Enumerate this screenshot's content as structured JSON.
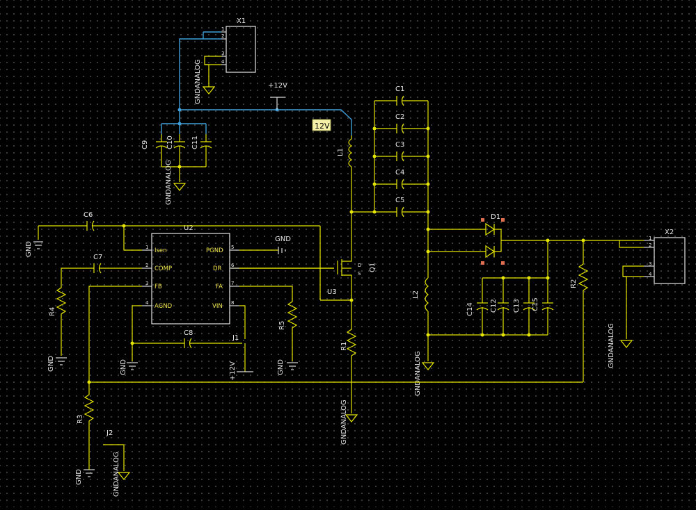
{
  "schematic": {
    "net_tag": "12V",
    "power_label": "+12V",
    "components": {
      "x1": {
        "ref": "X1",
        "pins": [
          "1",
          "2",
          "3",
          "4"
        ]
      },
      "x2": {
        "ref": "X2",
        "pins": [
          "1",
          "2",
          "3",
          "4"
        ]
      },
      "u2": {
        "ref": "U2",
        "left_pins": [
          {
            "num": "1",
            "name": "Isen"
          },
          {
            "num": "2",
            "name": "COMP"
          },
          {
            "num": "3",
            "name": "FB"
          },
          {
            "num": "4",
            "name": "AGND"
          }
        ],
        "right_pins": [
          {
            "num": "5",
            "name": "PGND"
          },
          {
            "num": "6",
            "name": "DR"
          },
          {
            "num": "7",
            "name": "FA"
          },
          {
            "num": "8",
            "name": "VIN"
          }
        ]
      },
      "u3": {
        "ref": "U3"
      },
      "q1": {
        "ref": "Q1",
        "pin_a": "D",
        "pin_b": "S"
      },
      "d1": {
        "ref": "D1"
      },
      "l1": {
        "ref": "L1"
      },
      "l2": {
        "ref": "L2"
      },
      "j1": {
        "ref": "J1"
      },
      "j2": {
        "ref": "J2"
      },
      "caps": [
        "C1",
        "C2",
        "C3",
        "C4",
        "C5",
        "C6",
        "C7",
        "C8",
        "C9",
        "C10",
        "C11",
        "C12",
        "C13",
        "C14",
        "C15"
      ],
      "resistors": [
        "R1",
        "R2",
        "R3",
        "R4",
        "R5"
      ]
    },
    "grounds": {
      "gnd": "GND",
      "gndanalog": "GNDANALOG"
    }
  }
}
